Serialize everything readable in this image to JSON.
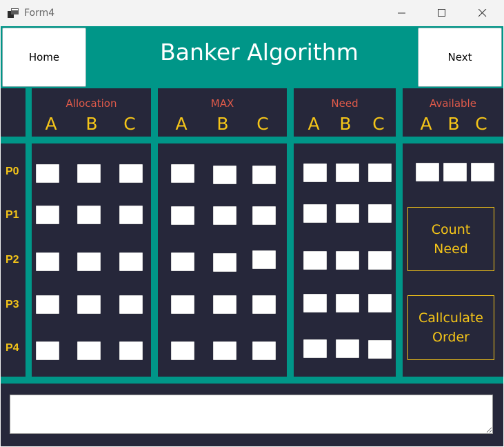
{
  "window": {
    "title": "Form4",
    "icon": "app-window-icon"
  },
  "header": {
    "home_label": "Home",
    "title": "Banker Algorithm",
    "next_label": "Next"
  },
  "sections": [
    {
      "key": "allocation",
      "label": "Allocation",
      "letters": [
        "A",
        "B",
        "C"
      ]
    },
    {
      "key": "max",
      "label": "MAX",
      "letters": [
        "A",
        "B",
        "C"
      ]
    },
    {
      "key": "need",
      "label": "Need",
      "letters": [
        "A",
        "B",
        "C"
      ]
    },
    {
      "key": "available",
      "label": "Available",
      "letters": [
        "A",
        "B",
        "C"
      ]
    }
  ],
  "processes": [
    "P0",
    "P1",
    "P2",
    "P3",
    "P4"
  ],
  "matrices": {
    "allocation": [
      [
        "",
        "",
        ""
      ],
      [
        "",
        "",
        ""
      ],
      [
        "",
        "",
        ""
      ],
      [
        "",
        "",
        ""
      ],
      [
        "",
        "",
        ""
      ]
    ],
    "max": [
      [
        "",
        "",
        ""
      ],
      [
        "",
        "",
        ""
      ],
      [
        "",
        "",
        ""
      ],
      [
        "",
        "",
        ""
      ],
      [
        "",
        "",
        ""
      ]
    ],
    "need": [
      [
        "",
        "",
        ""
      ],
      [
        "",
        "",
        ""
      ],
      [
        "",
        "",
        ""
      ],
      [
        "",
        "",
        ""
      ],
      [
        "",
        "",
        ""
      ]
    ],
    "available": [
      "",
      "",
      ""
    ]
  },
  "actions": {
    "count_need": "Count\nNeed",
    "calculate_order": "Callculate\nOrder"
  },
  "output": {
    "value": ""
  },
  "colors": {
    "background": "#26273a",
    "accent": "#009688",
    "section_label": "#e05a4a",
    "letter": "#f5c518"
  }
}
